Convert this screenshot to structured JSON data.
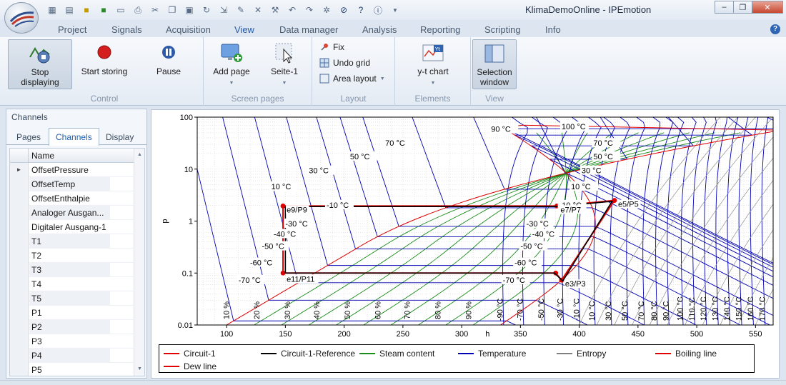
{
  "window": {
    "title": "KlimaDemoOnline - IPEmotion",
    "controls": [
      "minimize-icon",
      "restore-icon",
      "close-icon"
    ]
  },
  "ribbon": {
    "tabs": [
      {
        "label": "Project"
      },
      {
        "label": "Signals"
      },
      {
        "label": "Acquisition"
      },
      {
        "label": "View",
        "active": true
      },
      {
        "label": "Data manager"
      },
      {
        "label": "Analysis"
      },
      {
        "label": "Reporting"
      },
      {
        "label": "Scripting"
      },
      {
        "label": "Info"
      }
    ],
    "groups": {
      "control": {
        "label": "Control",
        "stop": "Stop displaying",
        "stop_line1": "Stop",
        "stop_line2": "displaying",
        "start_storing": "Start storing",
        "pause": "Pause"
      },
      "screen_pages": {
        "label": "Screen pages",
        "add_page": "Add page",
        "page": "Seite-1"
      },
      "layout": {
        "label": "Layout",
        "fix": "Fix",
        "undo_grid": "Undo grid",
        "area_layout": "Area layout"
      },
      "elements": {
        "label": "Elements",
        "yt_chart": "y-t chart"
      },
      "view": {
        "label": "View",
        "selection_line1": "Selection",
        "selection_line2": "window"
      }
    }
  },
  "channels_panel": {
    "title": "Channels",
    "tabs": [
      {
        "label": "Pages"
      },
      {
        "label": "Channels",
        "active": true
      },
      {
        "label": "Display"
      }
    ],
    "column": "Name",
    "rows": [
      "OffsetPressure",
      "OffsetTemp",
      "OffsetEnthalpie",
      "Analoger Ausgang-1",
      "Digitaler Ausgang-1",
      "T1",
      "T2",
      "T3",
      "T4",
      "T5",
      "P1",
      "P2",
      "P3",
      "P4",
      "P5"
    ],
    "display_rows": [
      "OffsetPressure",
      "OffsetTemp",
      "OffsetEnthalpie",
      "Analoger Ausgan...",
      "Digitaler Ausgang-1",
      "T1",
      "T2",
      "T3",
      "T4",
      "T5",
      "P1",
      "P2",
      "P3",
      "P4",
      "P5"
    ],
    "selected_row": 0
  },
  "chart_data": {
    "type": "line",
    "xlabel": "h",
    "ylabel": "p",
    "yscale": "log",
    "xlim": [
      75,
      565
    ],
    "ylim": [
      0.01,
      100
    ],
    "xticks": [
      100,
      150,
      200,
      250,
      300,
      350,
      400,
      450,
      500,
      550
    ],
    "yticks": [
      0.01,
      0.1,
      1,
      10,
      100
    ],
    "ytick_labels": [
      "0.01",
      "0.1",
      "1",
      "10",
      "100"
    ],
    "grid": true,
    "legend_position": "bottom",
    "legend": [
      {
        "name": "Circuit-1",
        "color": "#e00000"
      },
      {
        "name": "Circuit-1-Reference",
        "color": "#000000"
      },
      {
        "name": "Steam content",
        "color": "#1a8c1a"
      },
      {
        "name": "Temperature",
        "color": "#0000b4"
      },
      {
        "name": "Entropy",
        "color": "#808080"
      },
      {
        "name": "Boiling line",
        "color": "#e00000"
      },
      {
        "name": "Dew line",
        "color": "#e00000"
      }
    ],
    "series": [
      {
        "name": "Circuit-1",
        "points": [
          [
            148,
            1.95
          ],
          [
            381,
            1.95
          ],
          [
            430,
            2.5
          ],
          [
            385,
            0.073
          ],
          [
            380,
            0.1
          ],
          [
            148,
            0.1
          ],
          [
            148,
            1.95
          ]
        ]
      },
      {
        "name": "Circuit-1-Reference",
        "points": [
          [
            150,
            1.9
          ],
          [
            380,
            1.9
          ],
          [
            428,
            2.4
          ],
          [
            386,
            0.07
          ],
          [
            379,
            0.1
          ],
          [
            150,
            0.1
          ],
          [
            150,
            1.9
          ]
        ]
      }
    ],
    "point_labels": [
      {
        "text": "e9/P9",
        "x": 148,
        "y": 1.95
      },
      {
        "text": "e7/P7",
        "x": 381,
        "y": 1.95
      },
      {
        "text": "e5/P5",
        "x": 430,
        "y": 2.5
      },
      {
        "text": "e3/P3",
        "x": 385,
        "y": 0.073
      },
      {
        "text": "e11/P11",
        "x": 148,
        "y": 0.1
      }
    ],
    "dome_isotherm_labels": [
      {
        "text": "90 °C",
        "x": 325,
        "y": 52
      },
      {
        "text": "100 °C",
        "x": 385,
        "y": 58
      },
      {
        "text": "70 °C",
        "x": 235,
        "y": 28
      },
      {
        "text": "70 °C",
        "x": 412,
        "y": 28
      },
      {
        "text": "50 °C",
        "x": 205,
        "y": 15.5
      },
      {
        "text": "50 °C",
        "x": 412,
        "y": 15.5
      },
      {
        "text": "30 °C",
        "x": 170,
        "y": 8.3
      },
      {
        "text": "30 °C",
        "x": 402,
        "y": 8.3
      },
      {
        "text": "10 °C",
        "x": 138,
        "y": 4.1
      },
      {
        "text": "10 °C",
        "x": 393,
        "y": 4.1
      },
      {
        "text": "-10 °C",
        "x": 185,
        "y": 1.8
      },
      {
        "text": "-10 °C",
        "x": 383,
        "y": 1.8
      },
      {
        "text": "-30 °C",
        "x": 150,
        "y": 0.79
      },
      {
        "text": "-30 °C",
        "x": 355,
        "y": 0.79
      },
      {
        "text": "-40 °C",
        "x": 140,
        "y": 0.5
      },
      {
        "text": "-40 °C",
        "x": 360,
        "y": 0.5
      },
      {
        "text": "-50 °C",
        "x": 130,
        "y": 0.29
      },
      {
        "text": "-50 °C",
        "x": 350,
        "y": 0.29
      },
      {
        "text": "-60 °C",
        "x": 120,
        "y": 0.14
      },
      {
        "text": "-60 °C",
        "x": 345,
        "y": 0.14
      },
      {
        "text": "-70 °C",
        "x": 110,
        "y": 0.065
      },
      {
        "text": "-70 °C",
        "x": 335,
        "y": 0.065
      }
    ],
    "steam_content_labels": [
      "10 %",
      "20 %",
      "30 %",
      "40 %",
      "50 %",
      "60 %",
      "70 %",
      "80 %",
      "90 %"
    ],
    "steam_content_x": [
      102,
      128,
      154,
      179,
      205,
      231,
      256,
      282,
      308
    ],
    "superheat_labels": [
      "-90 °C",
      "-70 °C",
      "-50 °C",
      "-30 °C",
      "-10 °C",
      "10 °C",
      "30 °C",
      "50 °C",
      "70 °C",
      "80 °C",
      "90 °C",
      "100 °C",
      "110 °C",
      "120 °C",
      "130 °C",
      "140 °C",
      "150 °C",
      "160 °C",
      "170 °C"
    ],
    "superheat_x": [
      335,
      352,
      370,
      386,
      400,
      413,
      427,
      441,
      455,
      466,
      476,
      488,
      498,
      508,
      518,
      528,
      538,
      548,
      558
    ]
  }
}
